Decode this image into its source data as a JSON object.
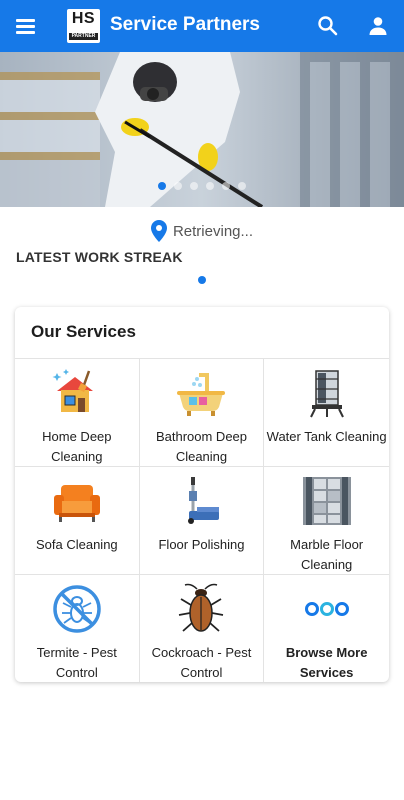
{
  "app": {
    "title": "Service Partners",
    "logo_text": "HS",
    "logo_subtext": "PARTNER",
    "accent_color": "#1679e8"
  },
  "header_icons": [
    "menu-icon",
    "search-icon",
    "account-icon"
  ],
  "banner": {
    "slide_count": 6,
    "active_slide": 1
  },
  "location": {
    "icon": "location-pin-icon",
    "text": "Retrieving..."
  },
  "streak": {
    "title": "LATEST WORK STREAK"
  },
  "services": {
    "title": "Our Services",
    "items": [
      {
        "label": "Home Deep Cleaning",
        "icon": "house-cleaning-icon"
      },
      {
        "label": "Bathroom Deep Cleaning",
        "icon": "bathtub-icon"
      },
      {
        "label": "Water Tank Cleaning",
        "icon": "water-tank-icon"
      },
      {
        "label": "Sofa Cleaning",
        "icon": "sofa-icon"
      },
      {
        "label": "Floor Polishing",
        "icon": "floor-polisher-icon"
      },
      {
        "label": "Marble Floor Cleaning",
        "icon": "marble-floor-icon"
      },
      {
        "label": "Termite - Pest Control",
        "icon": "no-termite-icon"
      },
      {
        "label": "Cockroach - Pest Control",
        "icon": "cockroach-icon"
      },
      {
        "label": "Browse More Services",
        "icon": "more-dots-icon"
      }
    ]
  }
}
